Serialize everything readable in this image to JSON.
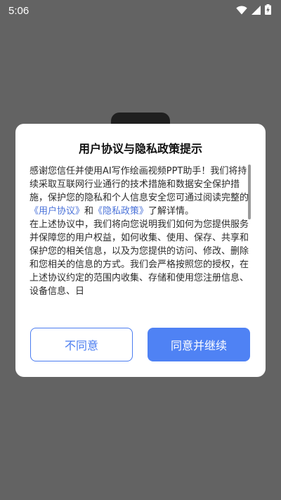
{
  "status_bar": {
    "time": "5:06",
    "icons": [
      "wifi-icon",
      "cellular-signal-icon",
      "battery-charging-icon"
    ]
  },
  "dialog": {
    "title": "用户协议与隐私政策提示",
    "paragraph1": {
      "intro": "感谢您信任并使用AI写作绘画视频PPT助手！我们将持续采取互联网行业通行的技术措施和数据安全保护措施，保护您的隐私和个人信息安全您可通过阅读完整的",
      "link_user_agreement": "《用户协议》",
      "and": "和",
      "link_privacy_policy": "《隐私政策》",
      "outro": "了解详情。"
    },
    "paragraph2": "在上述协议中，我们将向您说明我们如何为您提供服务并保障您的用户权益，如何收集、使用、保存、共享和保护您的相关信息，以及为您提供的访问、修改、删除和您相关的信息的方式。我们会严格按照您的授权，在上述协议约定的范围内收集、存储和使用您注册信息、设备信息、日",
    "disagree_label": "不同意",
    "agree_label": "同意并继续"
  },
  "colors": {
    "accent": "#4f82f4",
    "link": "#4a72d9",
    "overlay": "#636363"
  }
}
